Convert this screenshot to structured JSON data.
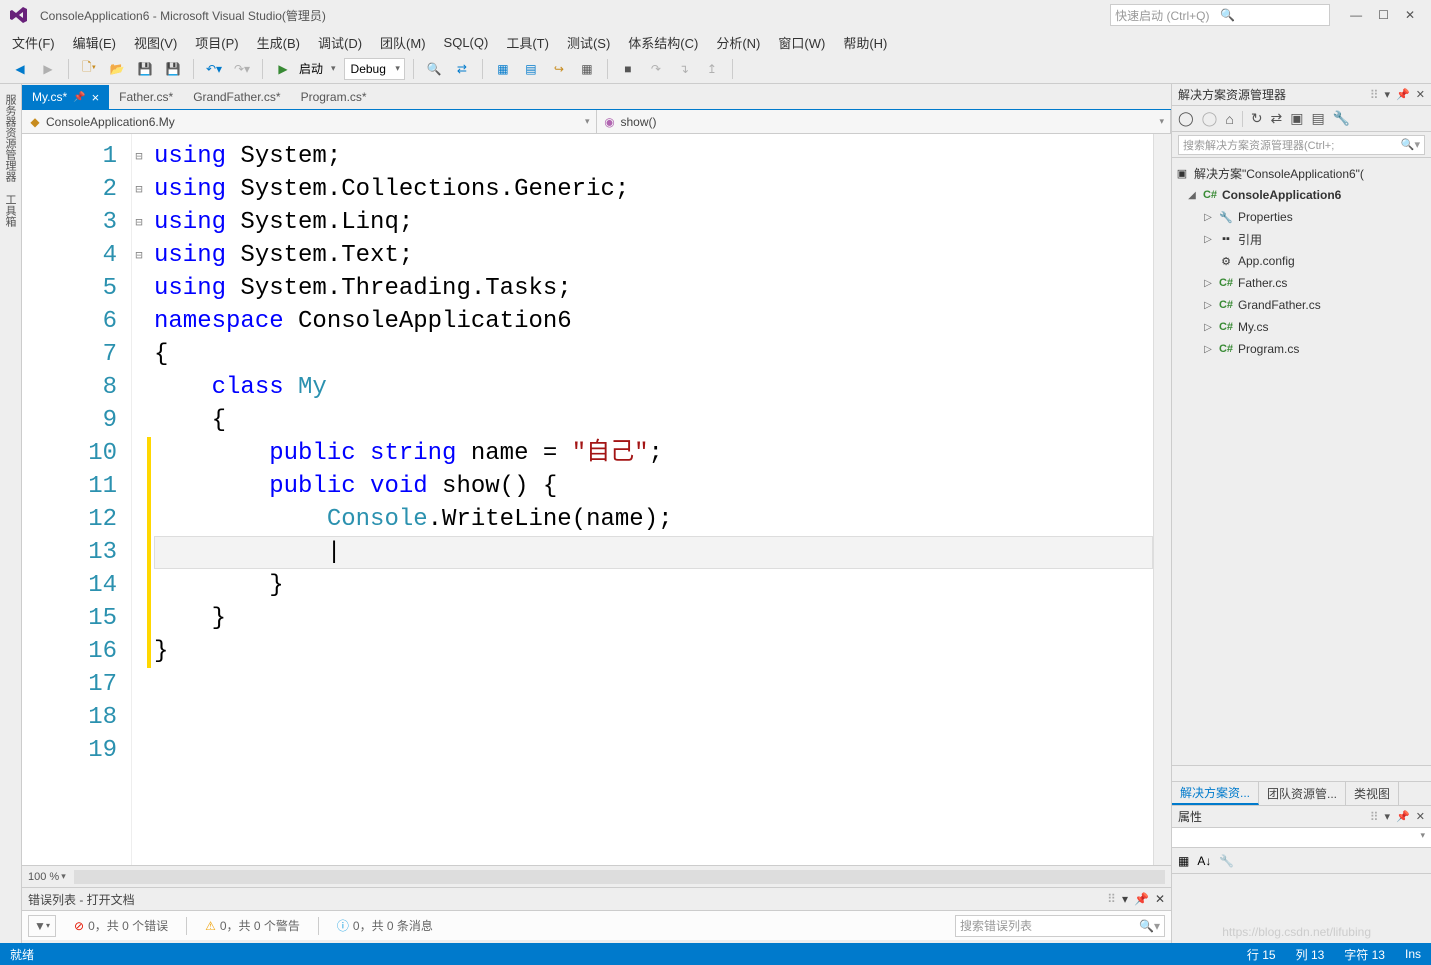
{
  "title": "ConsoleApplication6 - Microsoft Visual Studio(管理员)",
  "quick_launch_placeholder": "快速启动 (Ctrl+Q)",
  "menu": [
    "文件(F)",
    "编辑(E)",
    "视图(V)",
    "项目(P)",
    "生成(B)",
    "调试(D)",
    "团队(M)",
    "SQL(Q)",
    "工具(T)",
    "测试(S)",
    "体系结构(C)",
    "分析(N)",
    "窗口(W)",
    "帮助(H)"
  ],
  "toolbar": {
    "start": "启动",
    "config": "Debug"
  },
  "tabs": [
    {
      "label": "My.cs*",
      "active": true,
      "pinned": true
    },
    {
      "label": "Father.cs*"
    },
    {
      "label": "GrandFather.cs*"
    },
    {
      "label": "Program.cs*"
    }
  ],
  "breadcrumb": {
    "left": "ConsoleApplication6.My",
    "right": "show()"
  },
  "left_tabs": [
    "服务器资源管理器",
    "工具箱"
  ],
  "code_lines": [
    {
      "n": 1,
      "fold": "⊟",
      "html": "<span class='kw'>using</span> System;"
    },
    {
      "n": 2,
      "html": "<span class='kw'>using</span> System.Collections.Generic;"
    },
    {
      "n": 3,
      "html": "<span class='kw'>using</span> System.Linq;"
    },
    {
      "n": 4,
      "html": "<span class='kw'>using</span> System.Text;"
    },
    {
      "n": 5,
      "html": "<span class='kw'>using</span> System.Threading.Tasks;"
    },
    {
      "n": 6,
      "html": ""
    },
    {
      "n": 7,
      "fold": "⊟",
      "html": "<span class='kw'>namespace</span> ConsoleApplication6"
    },
    {
      "n": 8,
      "html": "{"
    },
    {
      "n": 9,
      "fold": "⊟",
      "html": "    <span class='kw'>class</span> <span class='type'>My</span>"
    },
    {
      "n": 10,
      "mod": true,
      "html": "    {"
    },
    {
      "n": 11,
      "mod": true,
      "html": "        <span class='kw'>public</span> <span class='kw'>string</span> name = <span class='str'>\"自己\"</span>;"
    },
    {
      "n": 12,
      "mod": true,
      "html": ""
    },
    {
      "n": 13,
      "mod": true,
      "fold": "⊟",
      "html": "        <span class='kw'>public</span> <span class='kw'>void</span> show() {"
    },
    {
      "n": 14,
      "mod": true,
      "html": "            <span class='type'>Console</span>.WriteLine(name);"
    },
    {
      "n": 15,
      "mod": true,
      "cursor": true,
      "html": "            |"
    },
    {
      "n": 16,
      "mod": true,
      "html": "        }"
    },
    {
      "n": 17,
      "html": "    }"
    },
    {
      "n": 18,
      "html": "}"
    },
    {
      "n": 19,
      "html": ""
    }
  ],
  "zoom": "100 %",
  "error_list": {
    "title": "错误列表 - 打开文档",
    "errors": "0，共 0 个错误",
    "warnings": "0，共 0 个警告",
    "messages": "0，共 0 条消息",
    "search_placeholder": "搜索错误列表"
  },
  "solution": {
    "title": "解决方案资源管理器",
    "search_placeholder": "搜索解决方案资源管理器(Ctrl+;",
    "root": "解决方案\"ConsoleApplication6\"(",
    "project": "ConsoleApplication6",
    "items": [
      "Properties",
      "引用",
      "App.config",
      "Father.cs",
      "GrandFather.cs",
      "My.cs",
      "Program.cs"
    ],
    "tabs": [
      "解决方案资...",
      "团队资源管...",
      "类视图"
    ]
  },
  "properties": {
    "title": "属性"
  },
  "status": {
    "ready": "就绪",
    "line": "行 15",
    "col": "列 13",
    "char": "字符 13",
    "ins": "Ins"
  },
  "watermark": "https://blog.csdn.net/lifubing"
}
